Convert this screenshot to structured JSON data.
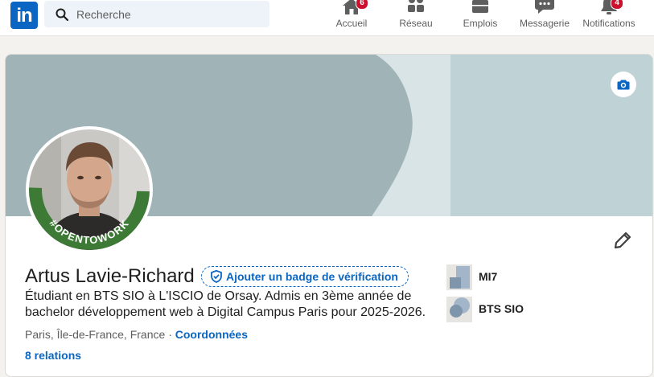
{
  "nav": {
    "search_placeholder": "Recherche",
    "items": [
      {
        "label": "Accueil",
        "icon": "home-icon",
        "badge": "6"
      },
      {
        "label": "Réseau",
        "icon": "network-icon"
      },
      {
        "label": "Emplois",
        "icon": "briefcase-icon"
      },
      {
        "label": "Messagerie",
        "icon": "messaging-icon"
      },
      {
        "label": "Notifications",
        "icon": "bell-icon",
        "badge": "4"
      }
    ]
  },
  "profile": {
    "name": "Artus Lavie-Richard",
    "verify_label": "Ajouter un badge de vérification",
    "headline": "Étudiant en BTS SIO à L'ISCIO de Orsay. Admis en 3ème année de bachelor développement web à Digital Campus Paris pour 2025-2026.",
    "location": "Paris, Île-de-France, France",
    "separator": "·",
    "contact_link": "Coordonnées",
    "relations": "8 relations",
    "open_to_work_frame": "#OPENTOWORK",
    "organizations": [
      {
        "label": "MI7"
      },
      {
        "label": "BTS SIO"
      }
    ]
  },
  "colors": {
    "brand_blue": "#0a66c2",
    "badge_red": "#cb112d",
    "open_to_work_green": "#3c7a35",
    "banner_dark": "#a0b4b8",
    "banner_light": "#d9e4e6",
    "banner_right": "#bfd2d5"
  }
}
